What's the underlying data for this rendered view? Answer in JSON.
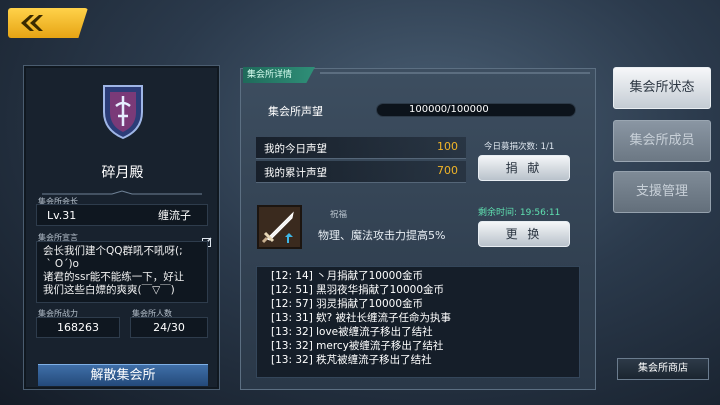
{
  "back_icon": "chevron-left-icon",
  "left_panel": {
    "emblem_icon": "shield-crest-icon",
    "club_name": "碎月殿",
    "leader_label": "集会所会长",
    "leader_level": "Lv.31",
    "leader_name": "缠流子",
    "declaration_label": "集会所宣言",
    "declaration_text": "会长我们建个QQ群吼不吼呀(;\n ` O´)o\n诸君的ssr能不能练一下，好让\n我们这些白嫖的爽爽(￣▽￣)",
    "edit_icon": "edit-icon",
    "power_label": "集会所战力",
    "power_value": "168263",
    "count_label": "集会所人数",
    "count_value": "24/30",
    "disband_label": "解散集会所"
  },
  "center": {
    "section_title": "集会所详情",
    "reputation_label": "集会所声望",
    "reputation_value": "100000/100000",
    "reputation_fill": 1.0,
    "today_label": "我的今日声望",
    "today_value": "100",
    "total_label": "我的累计声望",
    "total_value": "700",
    "donate_count": "今日募捐次数: 1/1",
    "donate_label": "捐 献",
    "buff_icon": "sword-icon",
    "buff_title": "祝福",
    "buff_desc": "物理、魔法攻击力提高5%",
    "remain_time": "剩余时间: 19:56:11",
    "change_label": "更 换",
    "log": [
      "[12: 14] 丶月捐献了10000金币",
      "[12: 51] 黑羽夜华捐献了10000金币",
      "[12: 57] 羽灵捐献了10000金币",
      "[13: 31] 欸? 被社长缠流子任命为执事",
      "[13: 32] love被缠流子移出了结社",
      "[13: 32] mercy被缠流子移出了结社",
      "[13: 32] 秩芃被缠流子移出了结社"
    ]
  },
  "nav": {
    "status_label": "集会所状态",
    "members_label": "集会所成员",
    "support_label": "支援管理",
    "shop_label": "集会所商店"
  },
  "colors": {
    "accent_gold": "#f0b428",
    "accent_green": "#5fe0b0",
    "back_button": "#f5be28"
  }
}
